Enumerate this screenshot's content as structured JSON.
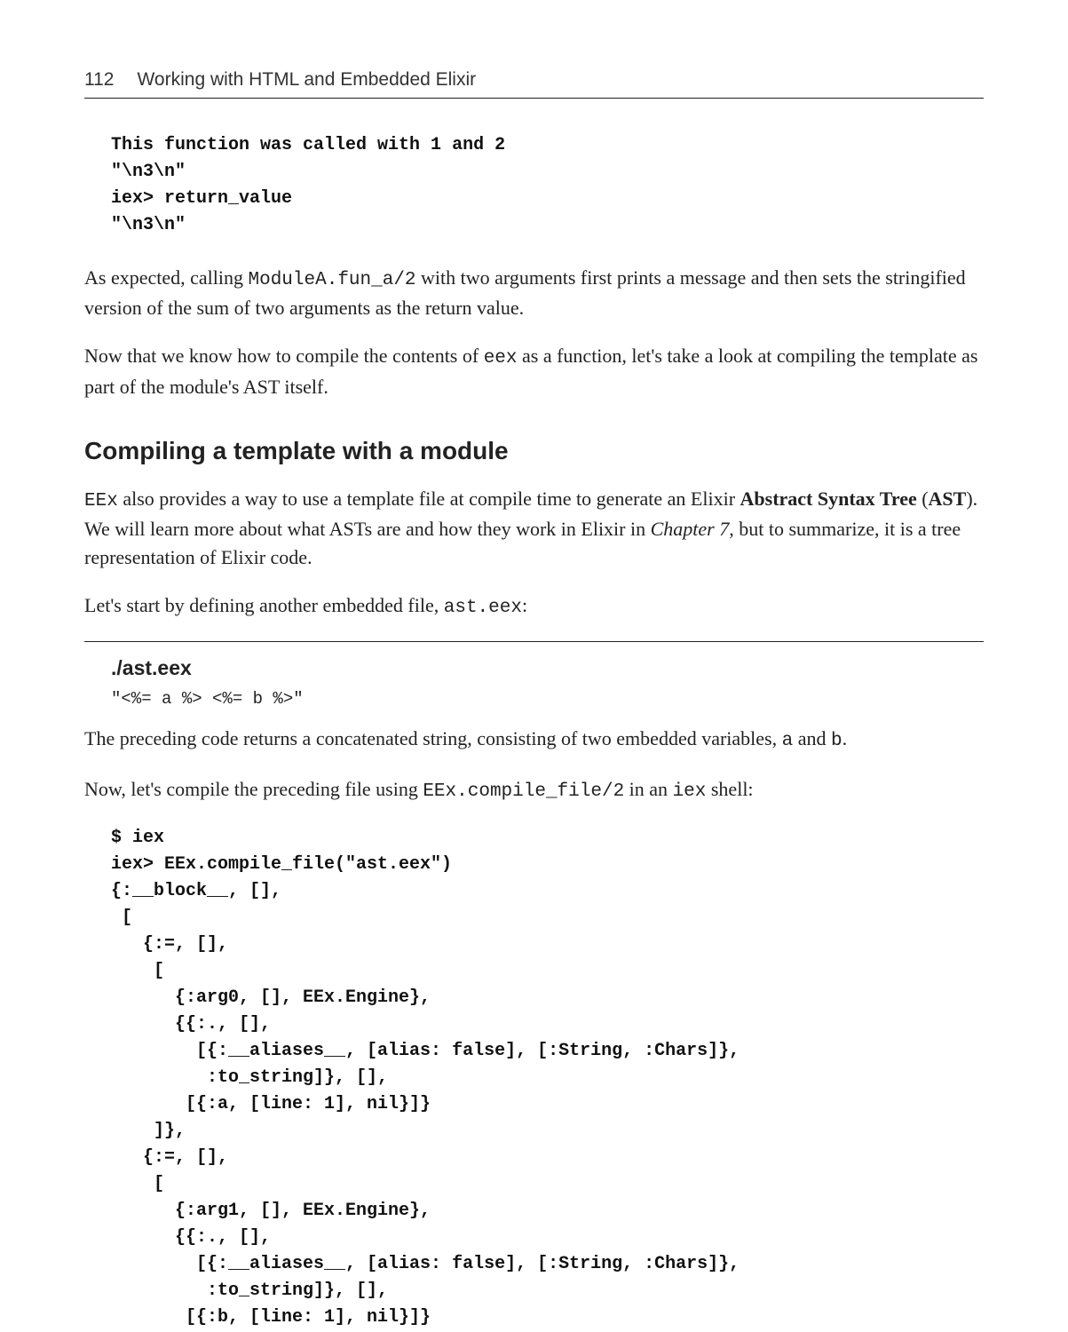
{
  "header": {
    "page_number": "112",
    "chapter_title": "Working with HTML and Embedded Elixir"
  },
  "code1": "This function was called with 1 and 2\n\"\\n3\\n\"\niex> return_value\n\"\\n3\\n\"",
  "para1_a": "As expected, calling ",
  "para1_code": "ModuleA.fun_a/2",
  "para1_b": " with two arguments first prints a message and then sets the stringified version of the sum of two arguments as the return value.",
  "para2_a": "Now that we know how to compile the contents of ",
  "para2_code": "eex",
  "para2_b": " as a function, let's take a look at compiling the template as part of the module's AST itself.",
  "section_heading": "Compiling a template with a module",
  "para3_a": "EEx",
  "para3_b": " also provides a way to use a template file at compile time to generate an Elixir ",
  "para3_c": "Abstract Syntax Tree",
  "para3_d": " (",
  "para3_e": "AST",
  "para3_f": "). We will learn more about what ASTs are and how they work in Elixir in ",
  "para3_g": "Chapter 7",
  "para3_h": ", but to summarize, it is a tree representation of Elixir code.",
  "para4_a": "Let's start by defining another embedded file, ",
  "para4_code": "ast.eex",
  "para4_b": ":",
  "file_heading": "./ast.eex",
  "file_code": "\"<%= a %> <%= b %>\"",
  "para5_a": "The preceding code returns a concatenated string, consisting of two embedded variables, ",
  "para5_code1": "a",
  "para5_b": " and ",
  "para5_code2": "b",
  "para5_c": ".",
  "para6_a": "Now, let's compile the preceding file using ",
  "para6_code1": "EEx.compile_file/2",
  "para6_b": " in an ",
  "para6_code2": "iex",
  "para6_c": " shell:",
  "code2": "$ iex\niex> EEx.compile_file(\"ast.eex\")\n{:__block__, [],\n [\n   {:=, [],\n    [\n      {:arg0, [], EEx.Engine},\n      {{:., [],\n        [{:__aliases__, [alias: false], [:String, :Chars]},\n         :to_string]}, [],\n       [{:a, [line: 1], nil}]}\n    ]},\n   {:=, [],\n    [\n      {:arg1, [], EEx.Engine},\n      {{:., [],\n        [{:__aliases__, [alias: false], [:String, :Chars]},\n         :to_string]}, [],\n       [{:b, [line: 1], nil}]}"
}
